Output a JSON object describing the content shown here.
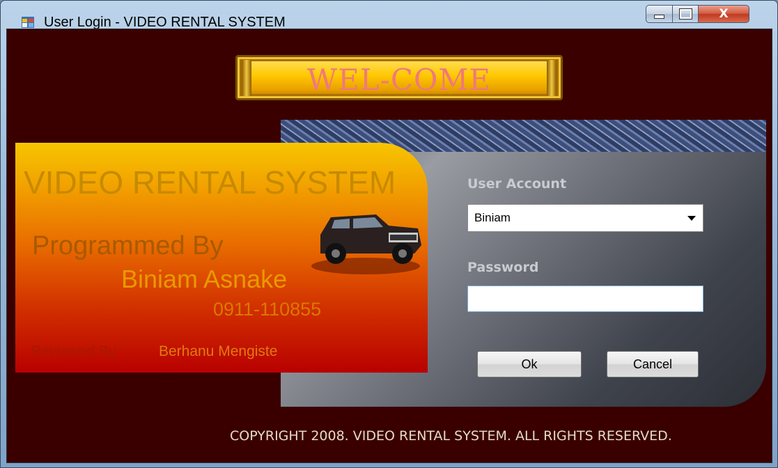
{
  "window": {
    "title": "User Login - VIDEO RENTAL SYSTEM",
    "controls": {
      "minimize": "minimize-icon",
      "maximize": "maximize-icon",
      "close_glyph": "X"
    }
  },
  "header": {
    "welcome": "WEL-COME"
  },
  "banner": {
    "title": "VIDEO RENTAL SYSTEM",
    "programmed_by": "Programmed By",
    "author": "Biniam Asnake",
    "phone": "0911-110855",
    "reviewed_by_label": "Reviewed By",
    "reviewer": "Berhanu Mengiste"
  },
  "login": {
    "account_label": "User Account",
    "account_value": "Biniam",
    "password_label": "Password",
    "password_value": "",
    "ok_label": "Ok",
    "cancel_label": "Cancel"
  },
  "footer": {
    "copyright": "COPYRIGHT 2008. VIDEO RENTAL SYSTEM. ALL RIGHTS  RESERVED."
  },
  "colors": {
    "client_bg": "#3a0000",
    "plaque": "#ffc800",
    "welcome_text": "#f07a78",
    "panel": "#5b5e66"
  }
}
